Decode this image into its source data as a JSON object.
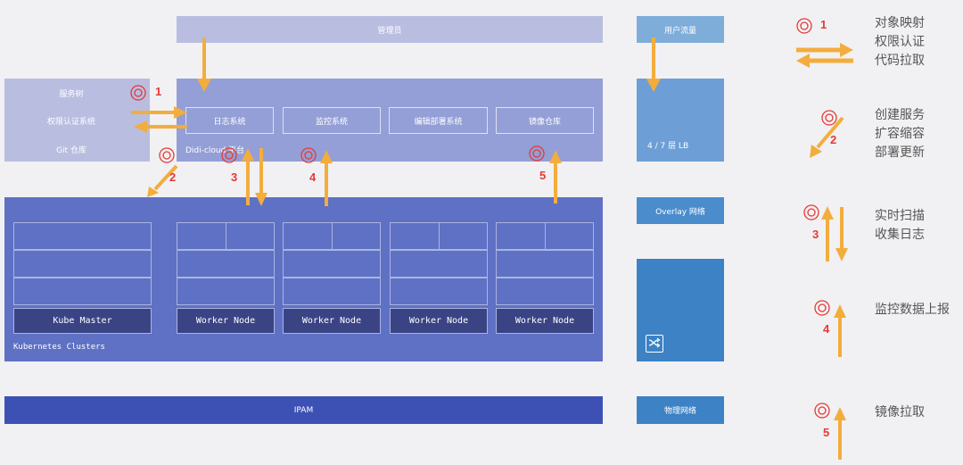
{
  "admin": {
    "label": "管理员"
  },
  "left_panel": {
    "items": [
      "服务树",
      "权限认证系统",
      "Git 仓库"
    ]
  },
  "platform": {
    "label": "Didi-cloud 平台",
    "boxes": [
      "日志系统",
      "监控系统",
      "编辑部署系统",
      "镜像仓库"
    ]
  },
  "cluster": {
    "label": "Kubernetes Clusters",
    "nodes": [
      "Kube Master",
      "Worker Node",
      "Worker Node",
      "Worker Node",
      "Worker Node"
    ]
  },
  "ipam": {
    "label": "IPAM"
  },
  "right": {
    "user_flow": "用户流量",
    "lb": "4 / 7 层 LB",
    "overlay": "Overlay 网络",
    "physical": "物理网络",
    "data_icon": "data-icon"
  },
  "markers": [
    "1",
    "2",
    "3",
    "4",
    "5"
  ],
  "legend": [
    {
      "num": "1",
      "lines": [
        "对象映射",
        "权限认证",
        "代码拉取"
      ]
    },
    {
      "num": "2",
      "lines": [
        "创建服务",
        "扩容缩容",
        "部署更新"
      ]
    },
    {
      "num": "3",
      "lines": [
        "实时扫描",
        "收集日志"
      ]
    },
    {
      "num": "4",
      "lines": [
        "监控数据上报"
      ]
    },
    {
      "num": "5",
      "lines": [
        "镜像拉取"
      ]
    }
  ],
  "colors": {
    "arrow": "#f3ad3d",
    "marker": "#e53935",
    "k8s": "#5f71c4",
    "platform": "#939fd6",
    "ipam": "#3c51b3"
  }
}
